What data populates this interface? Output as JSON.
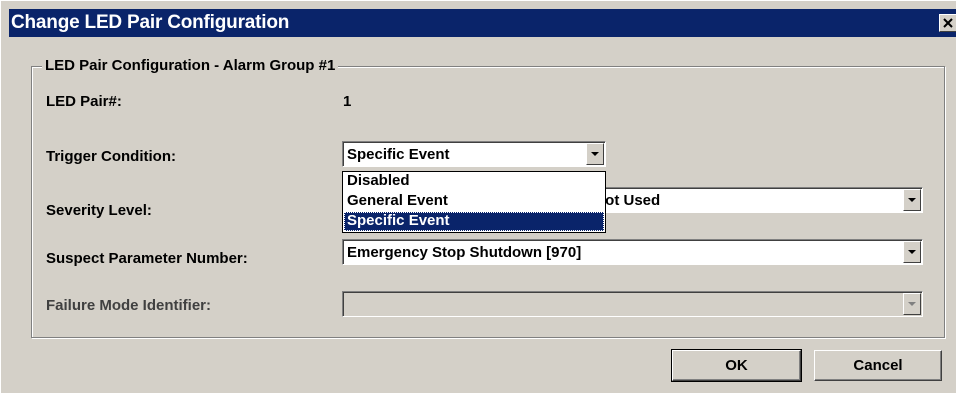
{
  "dialog": {
    "title": "Change LED Pair Configuration",
    "close_glyph": "close-icon"
  },
  "group": {
    "legend": "LED Pair Configuration - Alarm Group #1"
  },
  "fields": {
    "led_pair": {
      "label": "LED Pair#:",
      "value": "1"
    },
    "trigger_condition": {
      "label": "Trigger Condition:",
      "selected": "Specific Event",
      "options": [
        "Disabled",
        "General Event",
        "Specific Event"
      ],
      "expanded": true
    },
    "severity_level": {
      "label": "Severity Level:",
      "value_partial": "lot Used"
    },
    "spn": {
      "label": "Suspect Parameter Number:",
      "value": "Emergency Stop Shutdown [970]"
    },
    "fmi": {
      "label": "Failure Mode Identifier:",
      "value": "",
      "disabled": true
    }
  },
  "buttons": {
    "ok": "OK",
    "cancel": "Cancel"
  },
  "colors": {
    "titlebar": "#0a246a",
    "face": "#d4d0c8",
    "highlight": "#0a246a"
  }
}
